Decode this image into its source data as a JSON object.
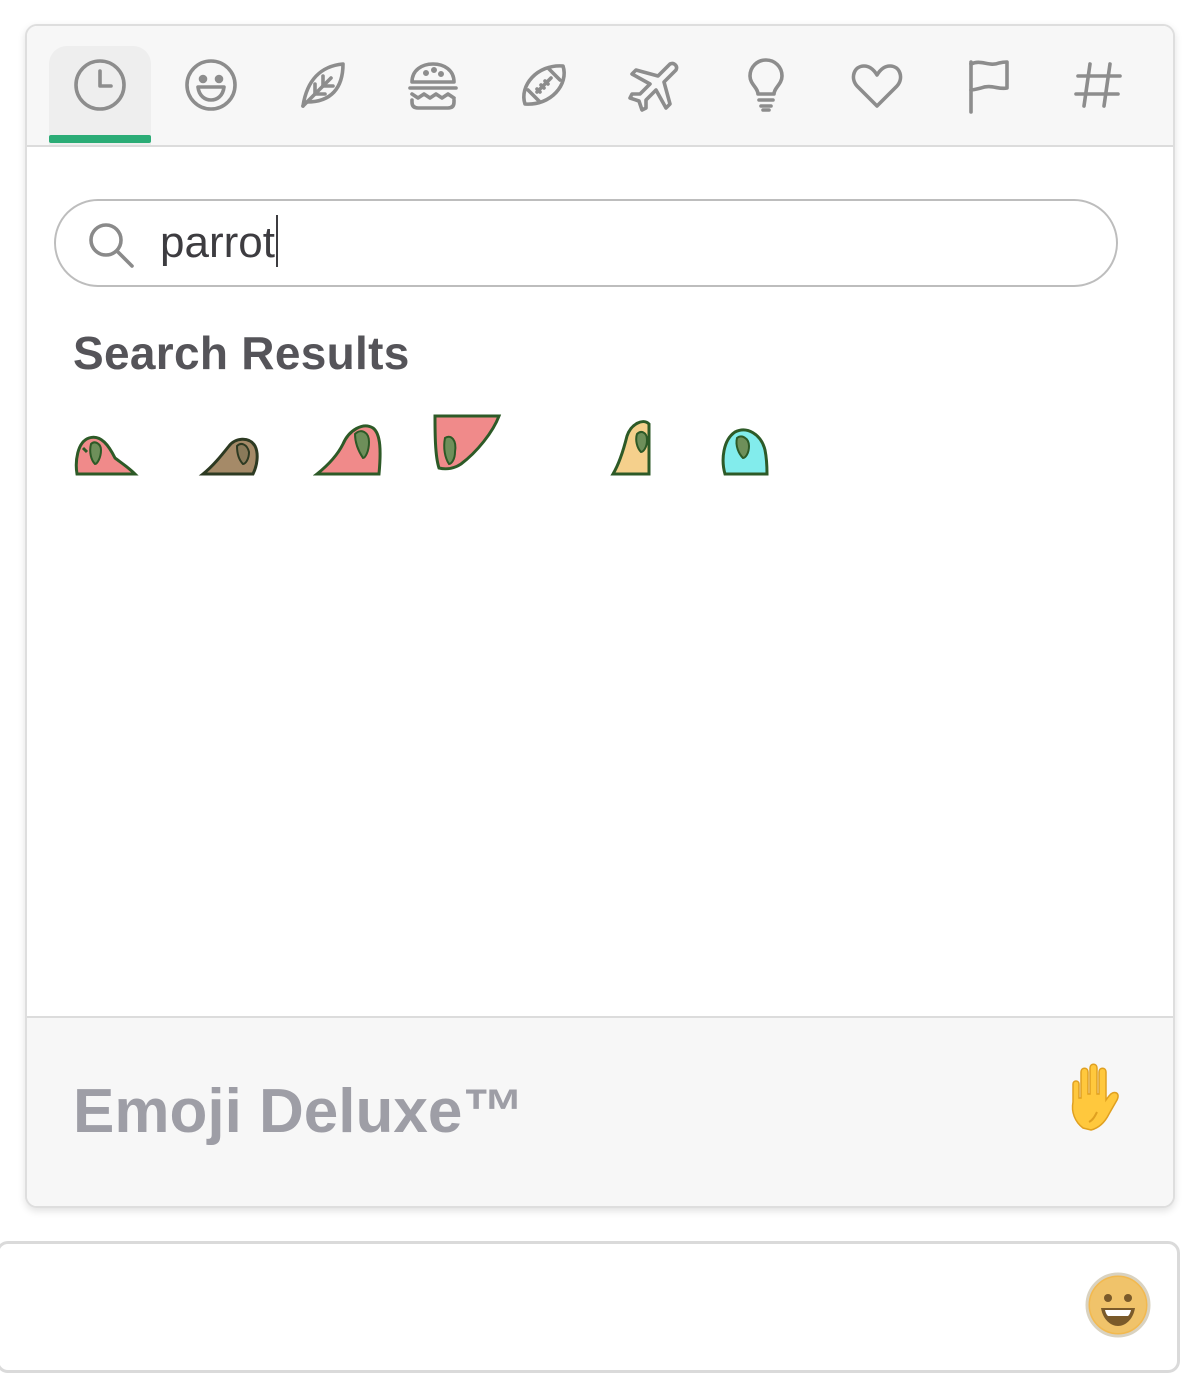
{
  "tabs": [
    {
      "name": "recent",
      "icon": "clock-icon",
      "active": true
    },
    {
      "name": "people",
      "icon": "smiley-icon"
    },
    {
      "name": "nature",
      "icon": "leaf-icon"
    },
    {
      "name": "food",
      "icon": "burger-icon"
    },
    {
      "name": "activity",
      "icon": "football-icon"
    },
    {
      "name": "travel",
      "icon": "airplane-icon"
    },
    {
      "name": "objects",
      "icon": "lightbulb-icon"
    },
    {
      "name": "symbols",
      "icon": "heart-icon"
    },
    {
      "name": "flags",
      "icon": "flag-icon"
    },
    {
      "name": "custom",
      "icon": "hashtag-icon"
    }
  ],
  "colors": {
    "active_underline": "#2bac76",
    "parrot_colors": [
      "#f08a8a",
      "#a58a68",
      "#f08a8a",
      "#f08a8a",
      "#f5d08c",
      "#82ecec"
    ],
    "parrot_outline": "#2d5a27"
  },
  "search": {
    "value": "parrot"
  },
  "results": {
    "title": "Search Results",
    "items": [
      {
        "icon": "parrot-icon"
      },
      {
        "icon": "parrot-icon"
      },
      {
        "icon": "parrot-icon"
      },
      {
        "icon": "parrot-icon"
      },
      {
        "icon": "parrot-icon"
      },
      {
        "icon": "parrot-icon"
      }
    ]
  },
  "footer": {
    "title": "Emoji Deluxe™",
    "skin_tone_icon": "raised-hand-icon"
  },
  "composer": {
    "emoji_button_icon": "smiley-icon"
  }
}
